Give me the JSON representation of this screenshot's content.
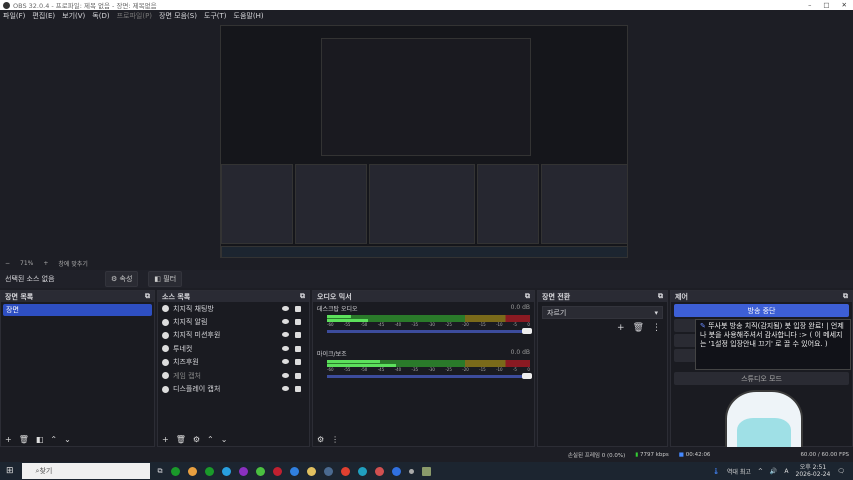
{
  "window": {
    "title": "OBS 32.0.4 - 프로파일: 제목 없음 - 장면: 제목없음"
  },
  "menu": [
    "파일(F)",
    "편집(E)",
    "보기(V)",
    "독(D)",
    "프로파일(P)",
    "장면 모음(S)",
    "도구(T)",
    "도움말(H)"
  ],
  "zoom": {
    "level": "71%",
    "fit_label": "창에 맞추기"
  },
  "source_toolbar": {
    "no_source": "선택된 소스 없음",
    "properties": "속성",
    "filters": "필터"
  },
  "scenes": {
    "title": "장면 목록",
    "items": [
      "장면"
    ]
  },
  "sources": {
    "title": "소스 목록",
    "items": [
      {
        "name": "치지직 채팅방",
        "dim": false
      },
      {
        "name": "치지직 알림",
        "dim": false
      },
      {
        "name": "치지직 미션후원",
        "dim": false
      },
      {
        "name": "투네컷",
        "dim": false
      },
      {
        "name": "치즈후원",
        "dim": false
      },
      {
        "name": "게임 캡처",
        "dim": true
      },
      {
        "name": "디스플레이 캡처",
        "dim": false
      }
    ]
  },
  "mixer": {
    "title": "오디오 믹서",
    "channels": [
      {
        "name": "데스크탑 오디오",
        "db": "0.0 dB",
        "level": 0.12
      },
      {
        "name": "마이크/보조",
        "db": "0.0 dB",
        "level": 0.26
      }
    ],
    "ticks": [
      "-60",
      "-55",
      "-50",
      "-45",
      "-40",
      "-35",
      "-30",
      "-25",
      "-20",
      "-15",
      "-10",
      "-5",
      "0"
    ]
  },
  "transitions": {
    "title": "장면 전환",
    "selected": "자르기"
  },
  "controls": {
    "title": "제어",
    "stop_stream": "방송 중단",
    "studio_mode": "스튜디오 모드"
  },
  "tooltip": {
    "text": "뚜사봇 방송 치직(감지됨) 봇 입장 완료! | 언제나 봇을 사용해주셔서 감사합니다 :> ( 이 메세지는 '1설정 입장안내 끄기' 로 끌 수 있어요. )"
  },
  "status": {
    "dropped": "손실된 프레임 0 (0.0%)",
    "bitrate": "7797 kbps",
    "time": "00:42:06",
    "fps": "60.00 / 60.00 FPS"
  },
  "taskbar": {
    "search": "찾기",
    "weather": "역대 최고",
    "time": "오후 2:51",
    "date": "2026-02-24",
    "ime": "A"
  }
}
